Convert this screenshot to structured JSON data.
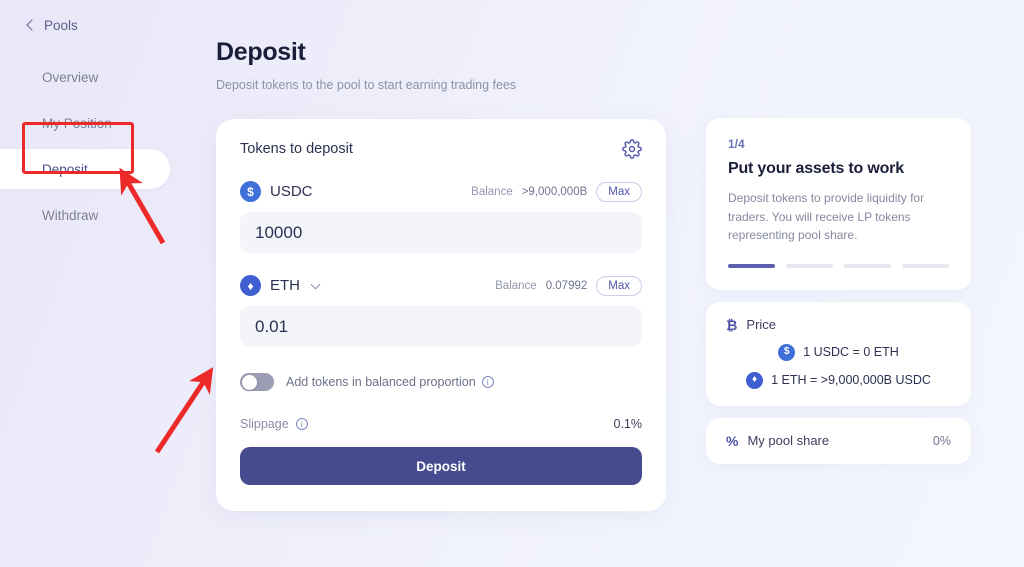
{
  "sidebar": {
    "back_label": "Pools",
    "back_icon": "chevron-left-icon",
    "items": [
      {
        "label": "Overview",
        "active": false
      },
      {
        "label": "My Position",
        "active": false
      },
      {
        "label": "Deposit",
        "active": true
      },
      {
        "label": "Withdraw",
        "active": false
      }
    ]
  },
  "main": {
    "title": "Deposit",
    "subtitle": "Deposit tokens to the pool to start earning trading fees",
    "card": {
      "heading": "Tokens to deposit",
      "settings_icon": "gear-icon",
      "tokens": [
        {
          "symbol": "USDC",
          "icon": "usdc-coin-icon",
          "glyph": "$",
          "has_selector": false,
          "balance_label": "Balance",
          "balance_value": ">9,000,000B",
          "max_label": "Max",
          "amount": "10000",
          "placeholder": "0.0"
        },
        {
          "symbol": "ETH",
          "icon": "eth-coin-icon",
          "glyph": "♦",
          "has_selector": true,
          "balance_label": "Balance",
          "balance_value": "0.07992",
          "max_label": "Max",
          "amount": "0.01",
          "placeholder": "0.0"
        }
      ],
      "balanced_toggle": {
        "label": "Add tokens in balanced proportion",
        "info_icon": "info-icon",
        "enabled": false
      },
      "slippage": {
        "label": "Slippage",
        "info_icon": "info-icon",
        "value": "0.1%"
      },
      "submit_label": "Deposit"
    }
  },
  "right": {
    "promo": {
      "step": "1/4",
      "title": "Put your assets to work",
      "body": "Deposit tokens to provide liquidity for traders. You will receive LP tokens representing pool share.",
      "dots": [
        true,
        false,
        false,
        false
      ]
    },
    "price": {
      "icon": "bitcoin-icon",
      "title": "Price",
      "rows": [
        {
          "icon": "usdc-coin-icon",
          "glyph": "$",
          "text": "1 USDC = 0 ETH"
        },
        {
          "icon": "eth-coin-icon",
          "glyph": "♦",
          "text": "1 ETH = >9,000,000B USDC"
        }
      ]
    },
    "pool_share": {
      "icon": "percent-icon",
      "label": "My pool share",
      "value": "0%"
    }
  },
  "annotations": {
    "highlight_color": "#ec2a2a",
    "arrow_count": 2
  }
}
